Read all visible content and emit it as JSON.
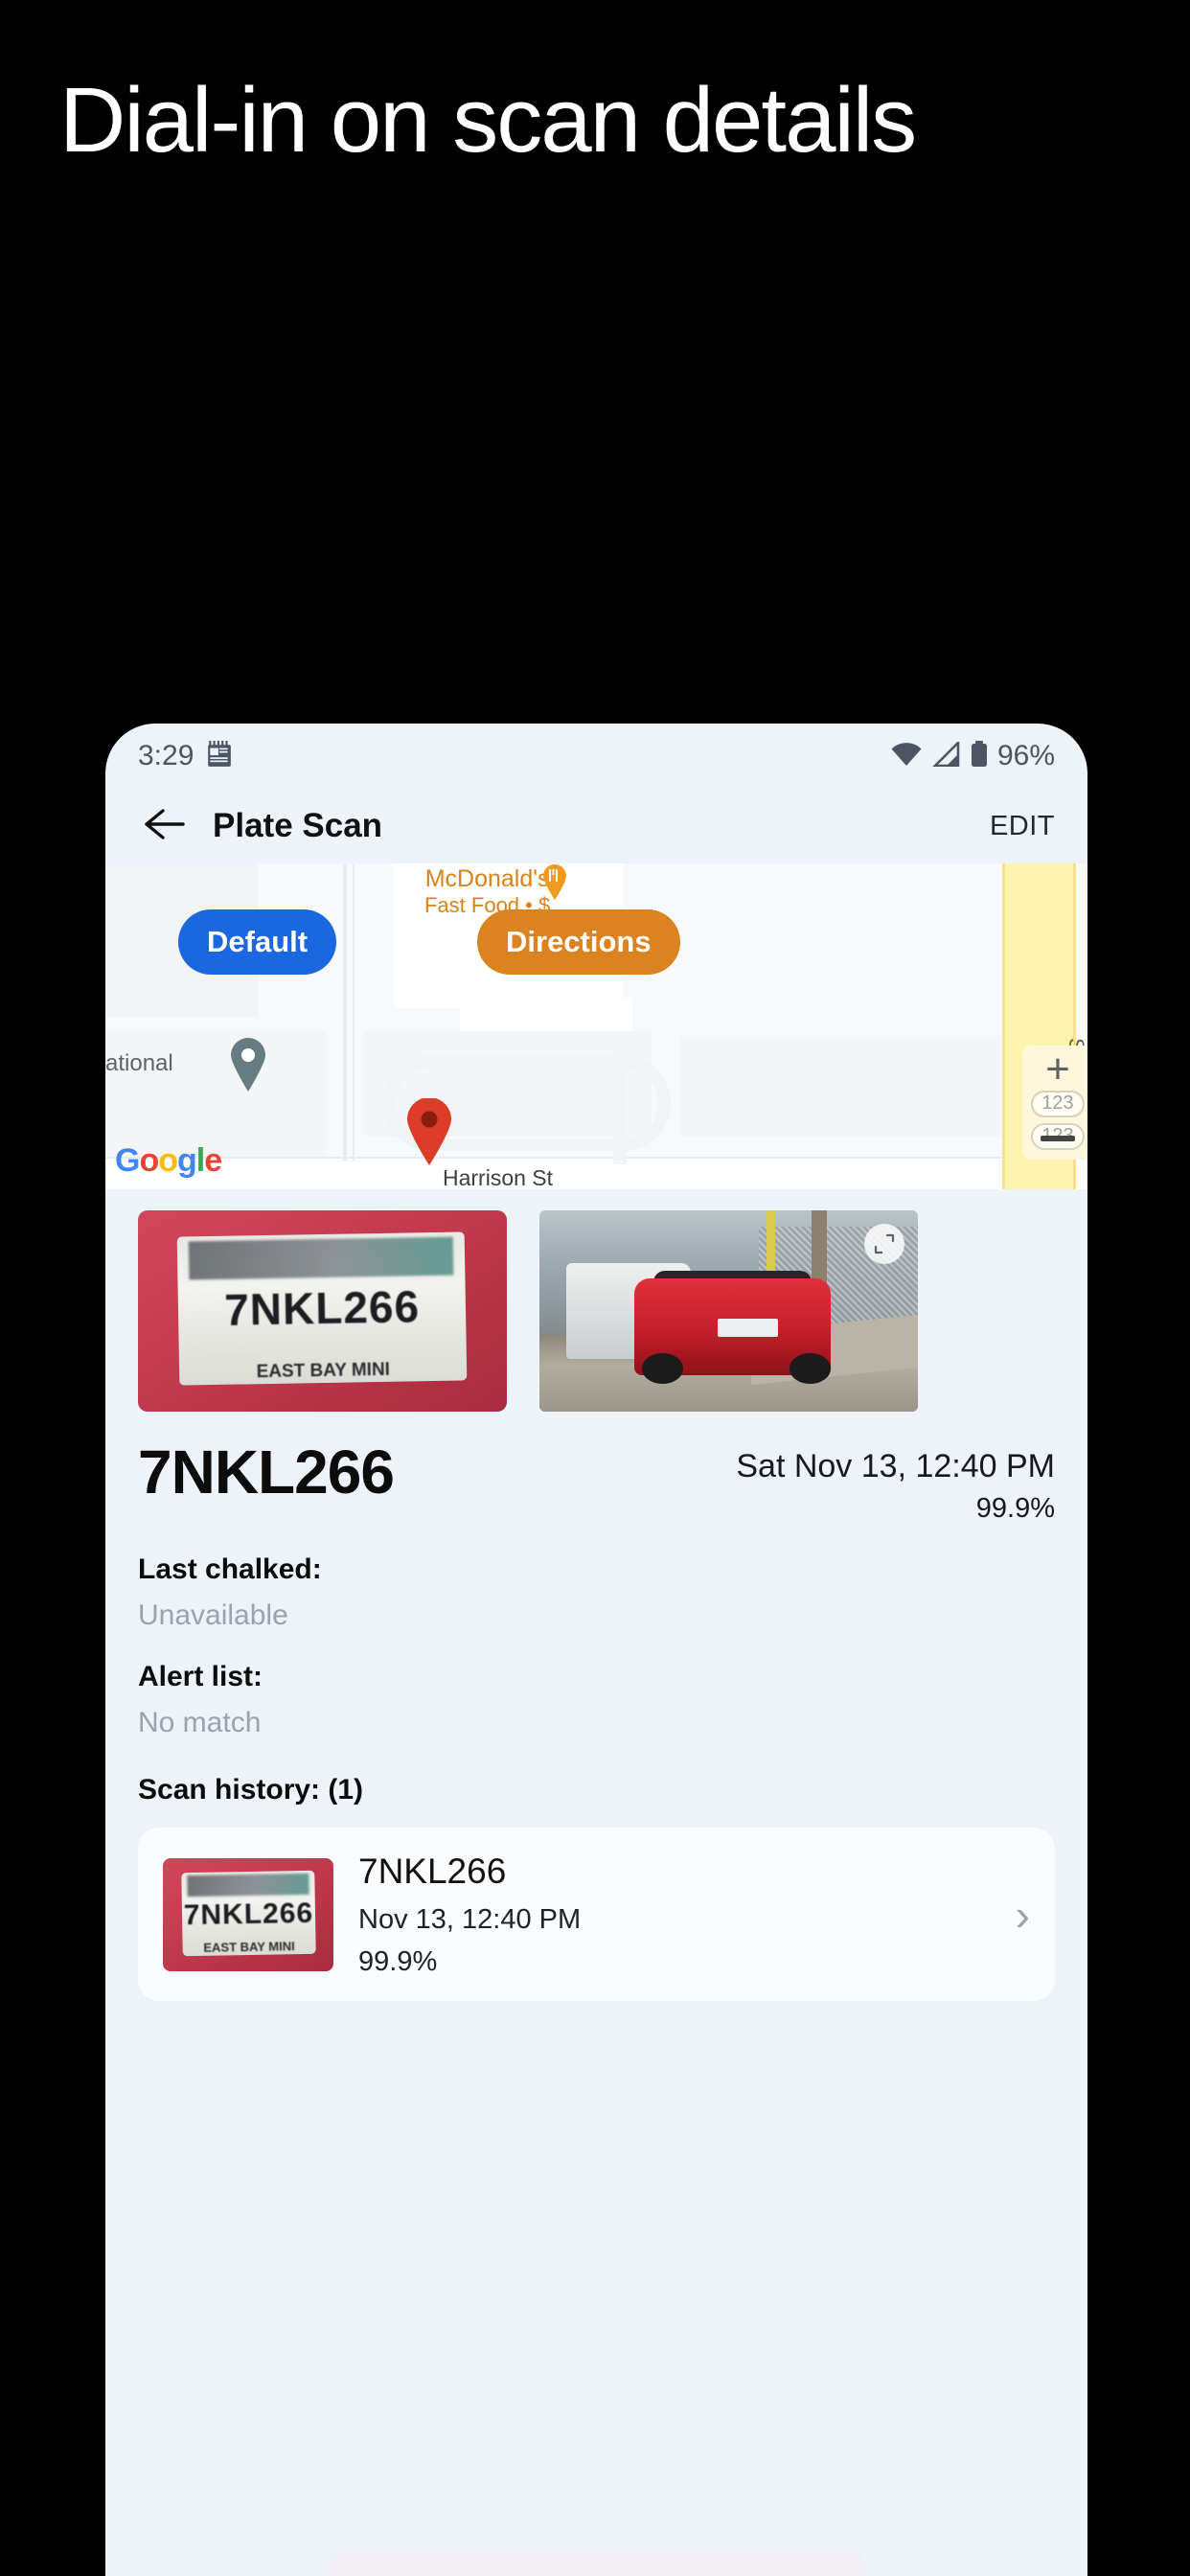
{
  "marketing": {
    "headline": "Dial-in on scan details"
  },
  "status_bar": {
    "time": "3:29",
    "notification_icon": "notepad-icon",
    "wifi_icon": "wifi-icon",
    "signal_icon": "signal-triangle-icon",
    "battery_icon": "battery-icon",
    "battery_percent": "96%"
  },
  "app_bar": {
    "back_icon": "back-arrow-icon",
    "title": "Plate Scan",
    "edit_label": "EDIT"
  },
  "map": {
    "default_button": "Default",
    "directions_button": "Directions",
    "poi_name": "McDonald's",
    "poi_subtitle": "Fast Food • $",
    "street_label_vertical": "San Pab",
    "street_label": "Harrison St",
    "partial_label": "ational",
    "attribution": "Google",
    "zoom_in_label": "+",
    "shield_label": "123",
    "shield_label_2": "123",
    "marker_primary": "map-pin-red",
    "marker_secondary": "map-pin-grey",
    "colors": {
      "default_btn": "#1a67e0",
      "directions_btn": "#da8320",
      "pin": "#dc3c28"
    }
  },
  "scan": {
    "plate_photo_alt": "license-plate-photo",
    "plate_text_on_photo": "7NKL266",
    "plate_frame_text": "EAST BAY MINI",
    "vehicle_photo_alt": "vehicle-photo",
    "expand_icon": "expand-icon",
    "plate_number": "7NKL266",
    "timestamp": "Sat Nov 13, 12:40 PM",
    "confidence": "99.9%",
    "last_chalked_label": "Last chalked:",
    "last_chalked_value": "Unavailable",
    "alert_list_label": "Alert list:",
    "alert_list_value": "No match",
    "scan_history_label": "Scan history: (1)"
  },
  "history": [
    {
      "plate": "7NKL266",
      "timestamp": "Nov 13, 12:40 PM",
      "confidence": "99.9%",
      "chevron": "chevron-right-icon"
    }
  ]
}
